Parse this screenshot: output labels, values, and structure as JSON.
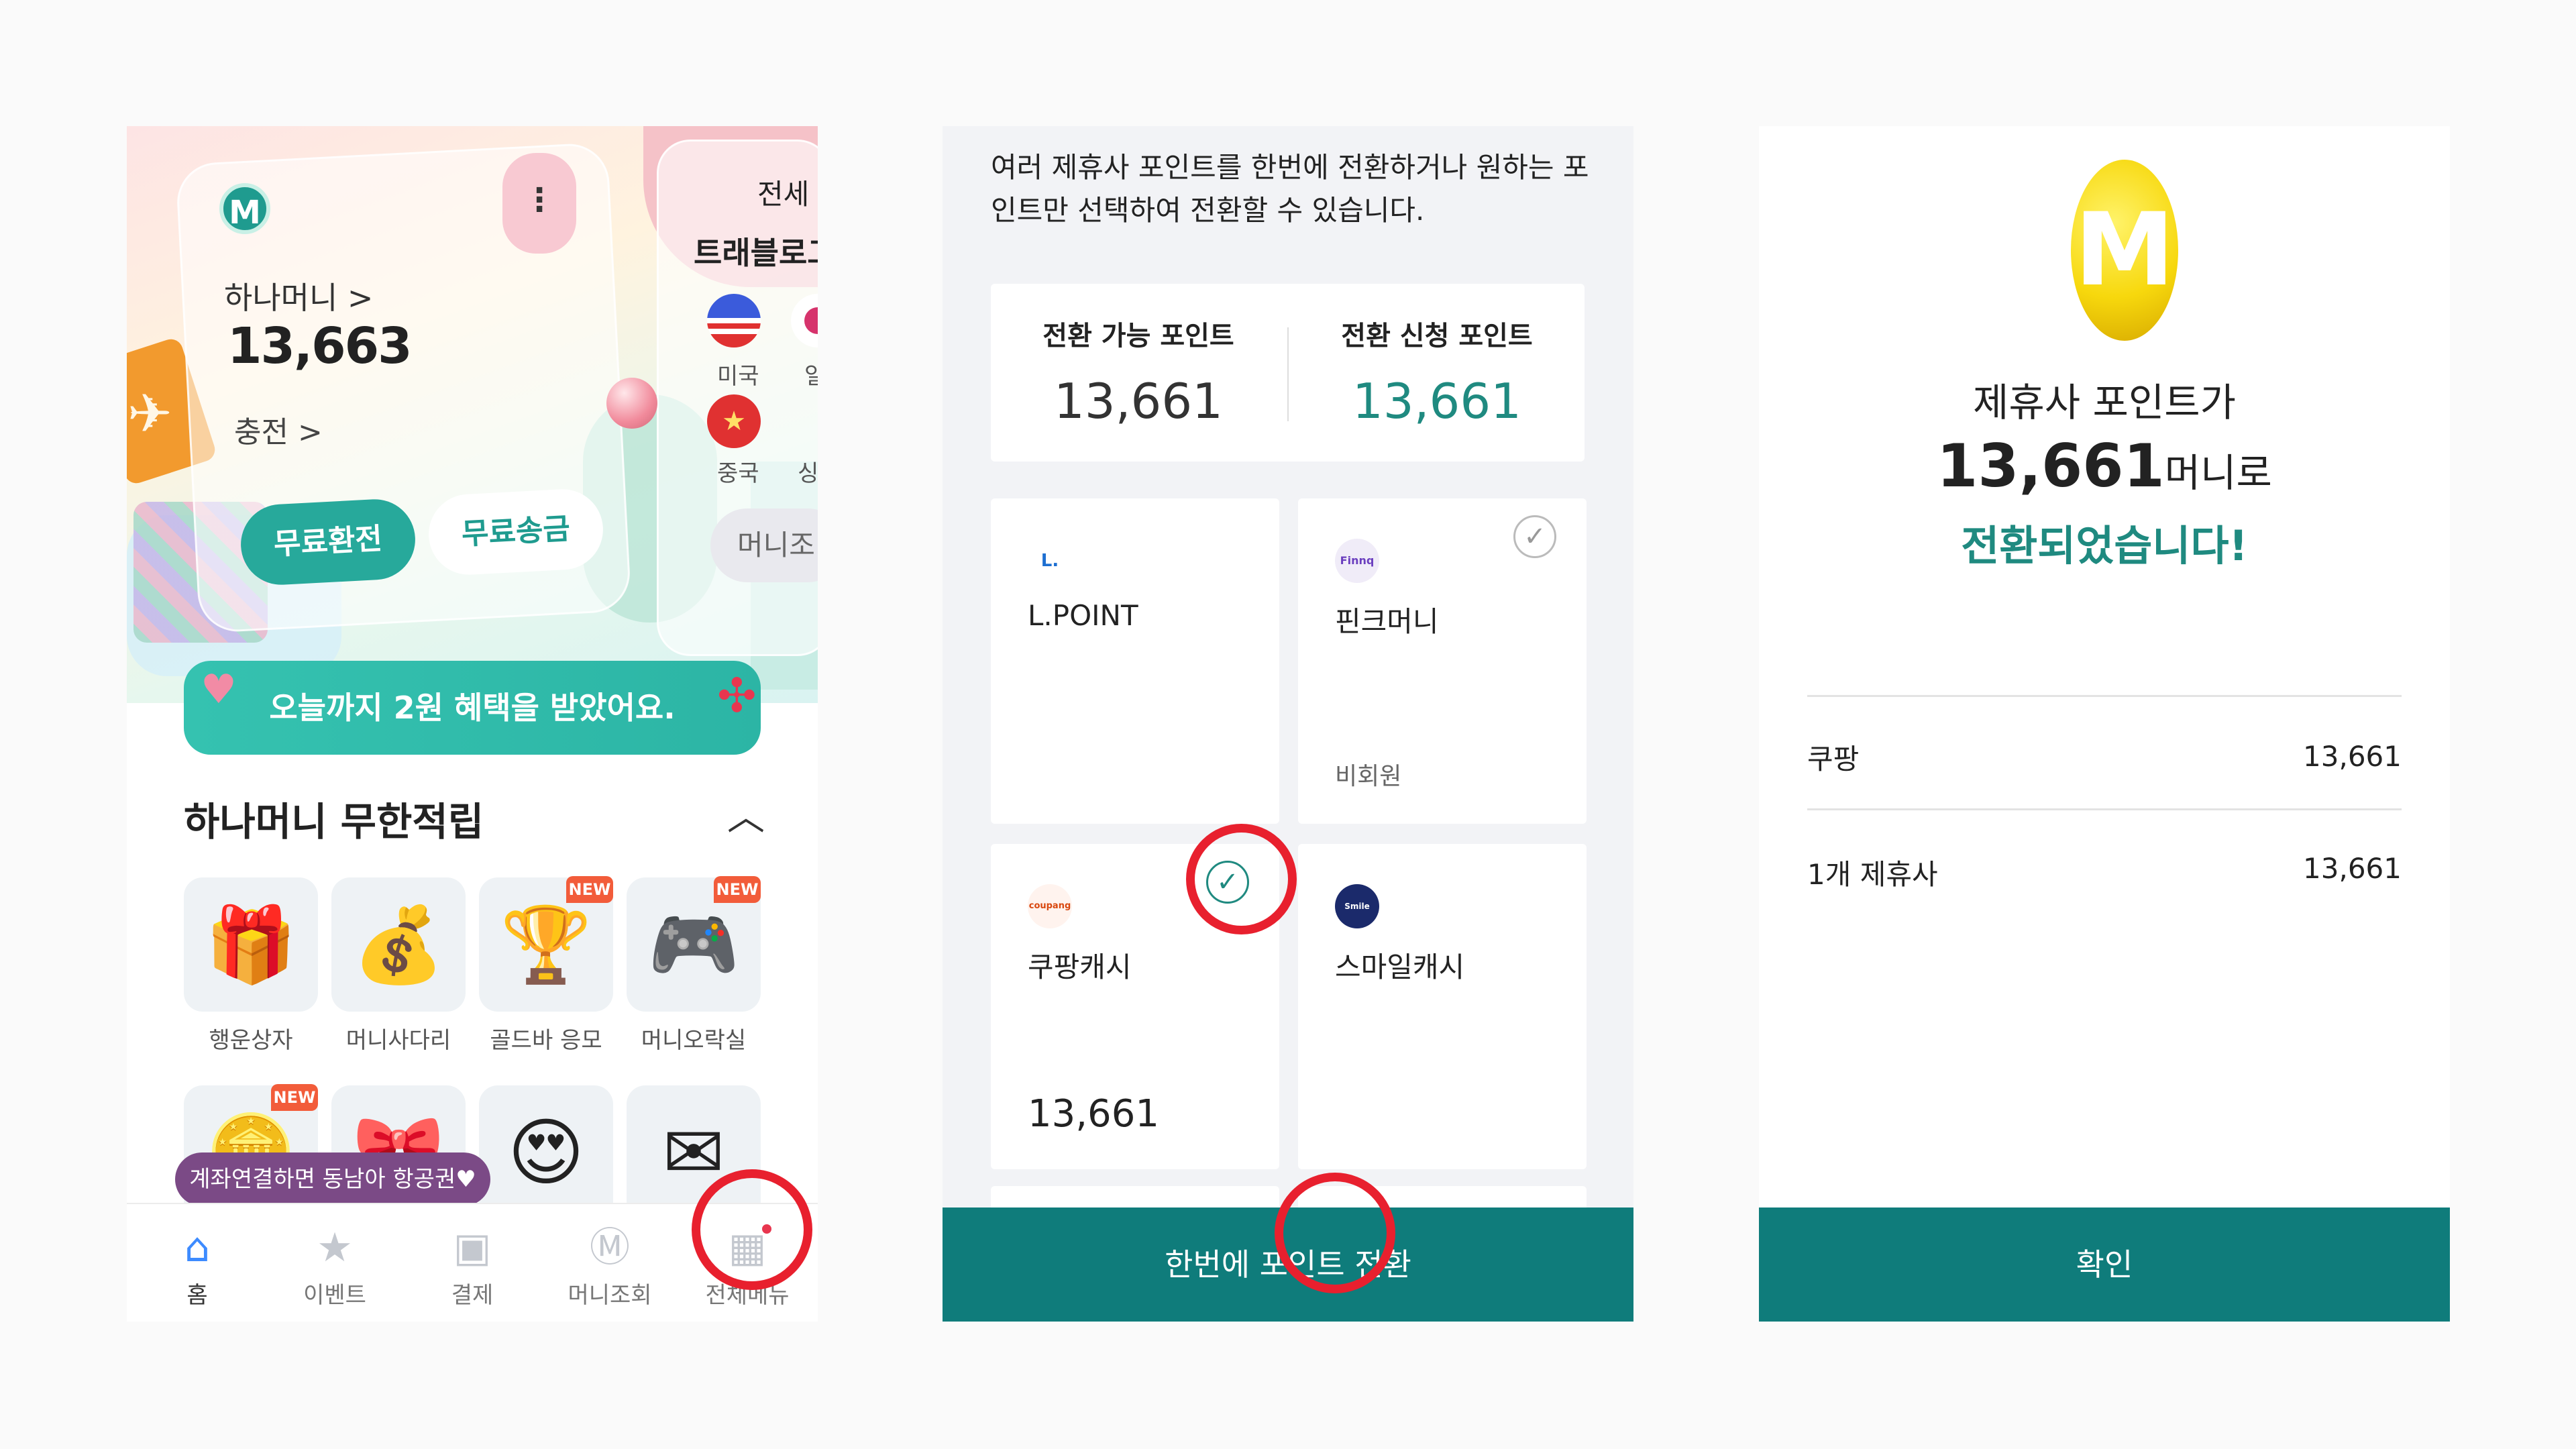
{
  "panel1": {
    "app_logo": "M",
    "balance_title": "하나머니 >",
    "balance_value": "13,663",
    "charge_link": "충전 >",
    "free_exchange": "무료환전",
    "free_transfer": "무료송금",
    "side_title_top": "전세",
    "side_title": "트래블로그",
    "countries": [
      "미국",
      "일",
      "중국",
      "싱"
    ],
    "side_pill": "머니조",
    "benefit_text": "오늘까지 2원 혜택을 받았어요.",
    "section_title": "하나머니 무한적립",
    "new_badge": "NEW",
    "tiles": [
      "행운상자",
      "머니사다리",
      "골드바 응모",
      "머니오락실"
    ],
    "tooltip": "계좌연결하면 동남아 항공권♥",
    "tabs": [
      "홈",
      "이벤트",
      "결제",
      "머니조회",
      "전체메뉴"
    ]
  },
  "panel2": {
    "description": "여러 제휴사 포인트를 한번에 전환하거나 원하는 포인트만 선택하여 전환할 수 있습니다.",
    "available_label": "전환 가능 포인트",
    "available_value": "13,661",
    "requested_label": "전환 신청 포인트",
    "requested_value": "13,661",
    "partners": [
      {
        "logo": "L.",
        "name": "L.POINT",
        "sub": ""
      },
      {
        "logo": "Finnq",
        "name": "핀크머니",
        "sub": "비회원"
      },
      {
        "logo": "coupang",
        "name": "쿠팡캐시",
        "points": "13,661"
      },
      {
        "logo": "Smile Cash",
        "name": "스마일캐시",
        "sub": ""
      }
    ],
    "cta": "한번에 포인트 전환"
  },
  "panel3": {
    "coin_letter": "M",
    "line1": "제휴사 포인트가",
    "amount": "13,661",
    "amount_suffix": "머니로",
    "line3": "전환되었습니다!",
    "rows": [
      {
        "label": "쿠팡",
        "value": "13,661"
      },
      {
        "label": "1개 제휴사",
        "value": "13,661"
      }
    ],
    "cta": "확인"
  },
  "colors": {
    "brand_teal": "#0f7c7b",
    "highlight_red": "#e8202e",
    "benefit_green": "#2cb5a5",
    "coin_yellow": "#f7d80d"
  }
}
